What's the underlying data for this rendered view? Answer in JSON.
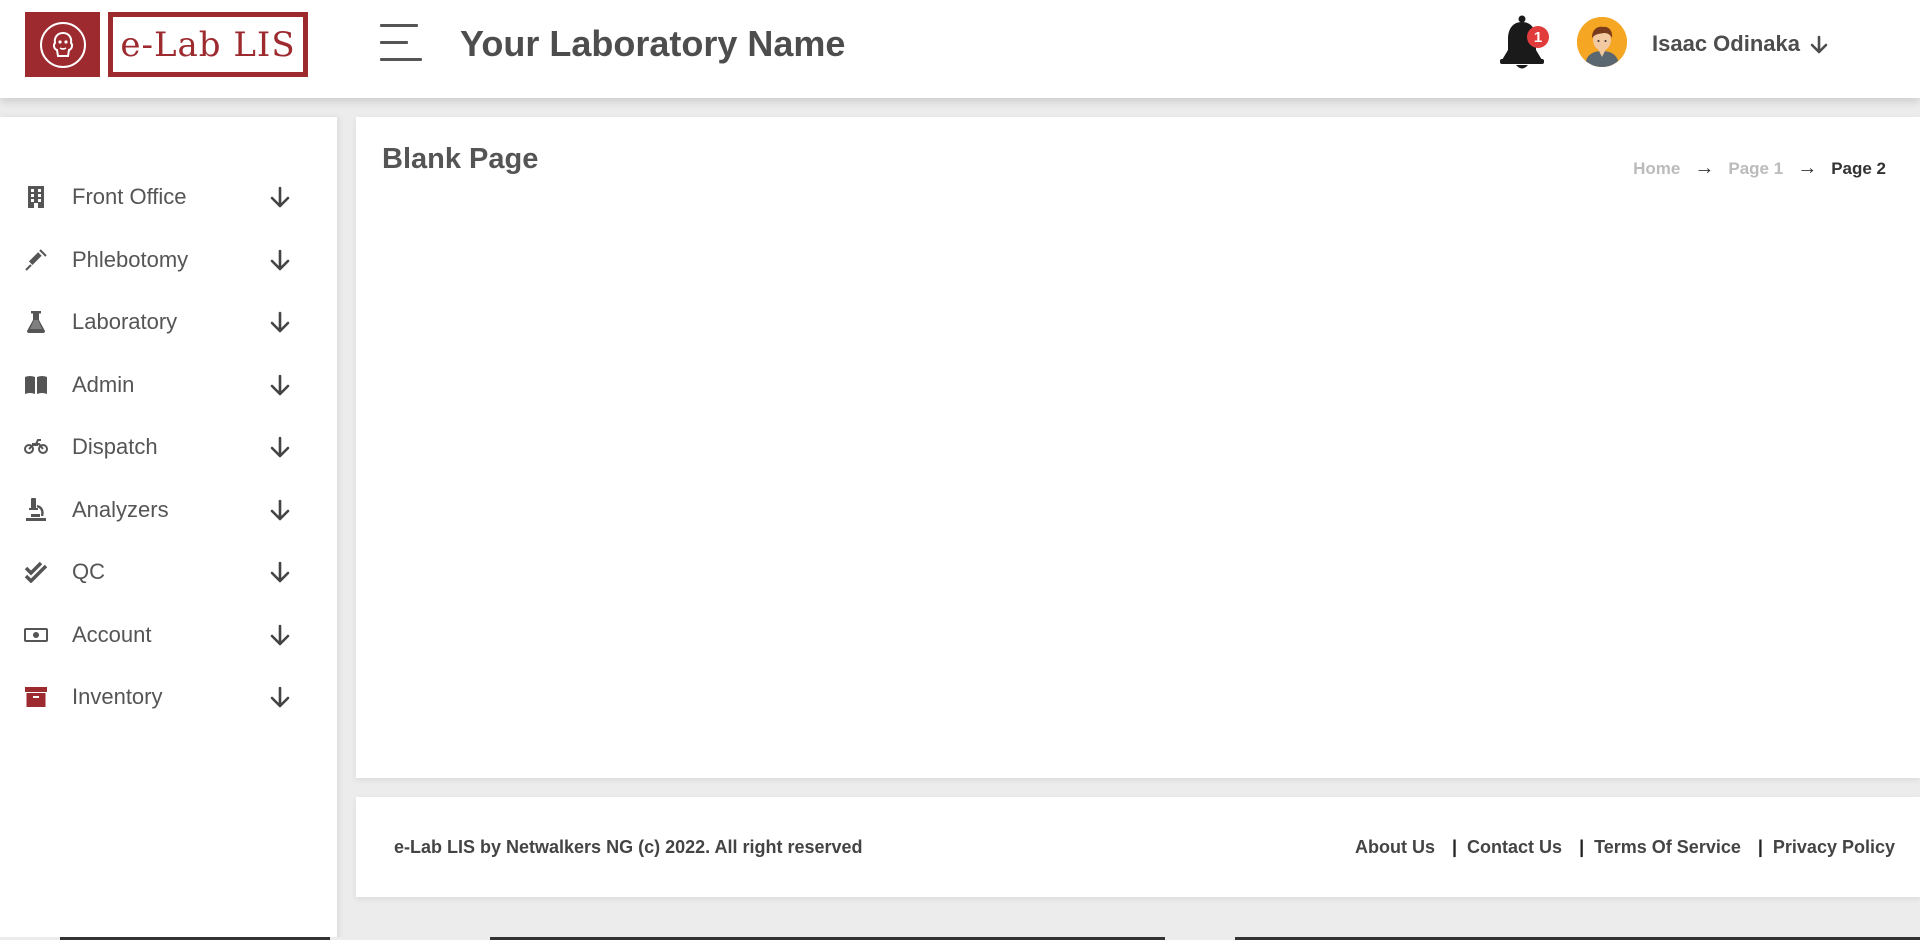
{
  "header": {
    "logo_text": "e-Lab LIS",
    "lab_name": "Your Laboratory Name",
    "notifications": {
      "count": "1",
      "icon": "bell-icon"
    },
    "user": {
      "name": "Isaac Odinaka",
      "avatar_color": "#f5a623"
    }
  },
  "sidebar": {
    "items": [
      {
        "label": "Front Office",
        "icon": "building-icon"
      },
      {
        "label": "Phlebotomy",
        "icon": "syringe-icon"
      },
      {
        "label": "Laboratory",
        "icon": "flask-icon"
      },
      {
        "label": "Admin",
        "icon": "book-icon"
      },
      {
        "label": "Dispatch",
        "icon": "motorcycle-icon"
      },
      {
        "label": "Analyzers",
        "icon": "microscope-icon"
      },
      {
        "label": "QC",
        "icon": "double-check-icon"
      },
      {
        "label": "Account",
        "icon": "money-bill-icon"
      },
      {
        "label": "Inventory",
        "icon": "archive-box-icon"
      }
    ]
  },
  "main": {
    "title": "Blank Page",
    "breadcrumb": [
      {
        "label": "Home"
      },
      {
        "label": "Page 1"
      },
      {
        "label": "Page 2"
      }
    ],
    "breadcrumb_separator": "→"
  },
  "footer": {
    "copyright": "e-Lab LIS by Netwalkers NG (c) 2022. All right reserved",
    "links": [
      {
        "label": "About Us"
      },
      {
        "label": "Contact Us"
      },
      {
        "label": "Terms Of Service"
      },
      {
        "label": "Privacy Policy"
      }
    ],
    "link_separator": "|"
  },
  "colors": {
    "brand": "#9c2a2e",
    "text": "#555555",
    "badge": "#e23b3b",
    "background": "#ececec"
  }
}
